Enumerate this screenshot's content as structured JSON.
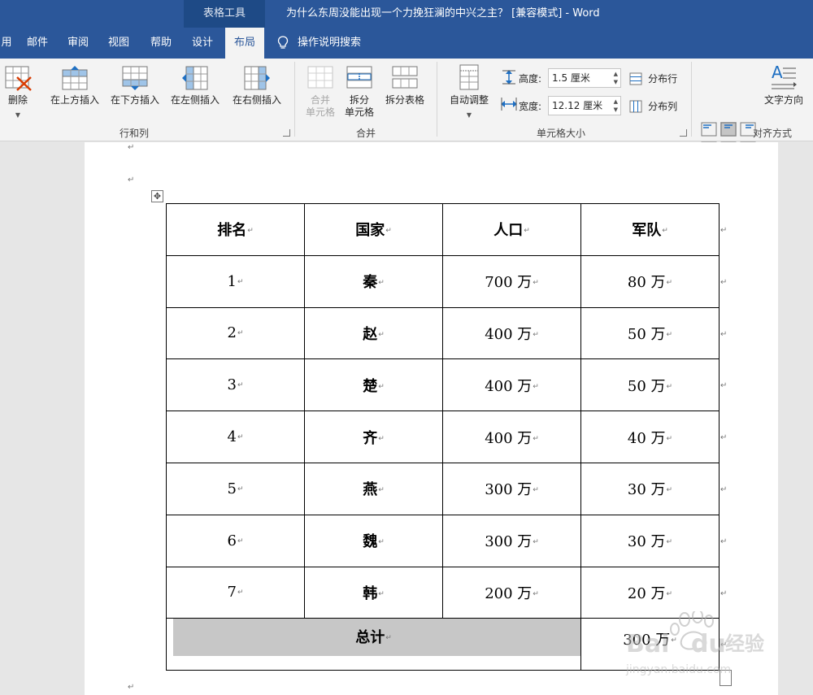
{
  "title_bar": {
    "context_tab": "表格工具",
    "document_title": "为什么东周没能出现一个力挽狂澜的中兴之主？ [兼容模式] - Word"
  },
  "tabs": [
    {
      "label": "用"
    },
    {
      "label": "邮件"
    },
    {
      "label": "审阅"
    },
    {
      "label": "视图"
    },
    {
      "label": "帮助"
    },
    {
      "label": "设计"
    },
    {
      "label": "布局",
      "active": true
    }
  ],
  "tell_me": "操作说明搜索",
  "ribbon": {
    "rows_cols": {
      "delete": "删除",
      "insert_above": "在上方插入",
      "insert_below": "在下方插入",
      "insert_left": "在左侧插入",
      "insert_right": "在右侧插入",
      "group_label": "行和列"
    },
    "merge": {
      "merge_cells_1": "合并",
      "merge_cells_2": "单元格",
      "split_cells_1": "拆分",
      "split_cells_2": "单元格",
      "split_table": "拆分表格",
      "group_label": "合并"
    },
    "cell_size": {
      "autofit": "自动调整",
      "height_label": "高度:",
      "height_value": "1.5 厘米",
      "width_label": "宽度:",
      "width_value": "12.12 厘米",
      "distribute_rows": "分布行",
      "distribute_cols": "分布列",
      "group_label": "单元格大小"
    },
    "alignment": {
      "text_direction": "文字方向",
      "group_label": "对齐方式"
    }
  },
  "table": {
    "headers": [
      "排名",
      "国家",
      "人口",
      "军队"
    ],
    "rows": [
      [
        "1",
        "秦",
        "700 万",
        "80 万"
      ],
      [
        "2",
        "赵",
        "400 万",
        "50 万"
      ],
      [
        "3",
        "楚",
        "400 万",
        "50 万"
      ],
      [
        "4",
        "齐",
        "400 万",
        "40 万"
      ],
      [
        "5",
        "燕",
        "300 万",
        "30 万"
      ],
      [
        "6",
        "魏",
        "300 万",
        "30 万"
      ],
      [
        "7",
        "韩",
        "200 万",
        "20 万"
      ]
    ],
    "total_label": "总计",
    "total_value": "300 万"
  },
  "paragraph_mark": "↵",
  "watermark": {
    "brand": "Bai du 经验",
    "url": "jingyan.baidu.com"
  }
}
